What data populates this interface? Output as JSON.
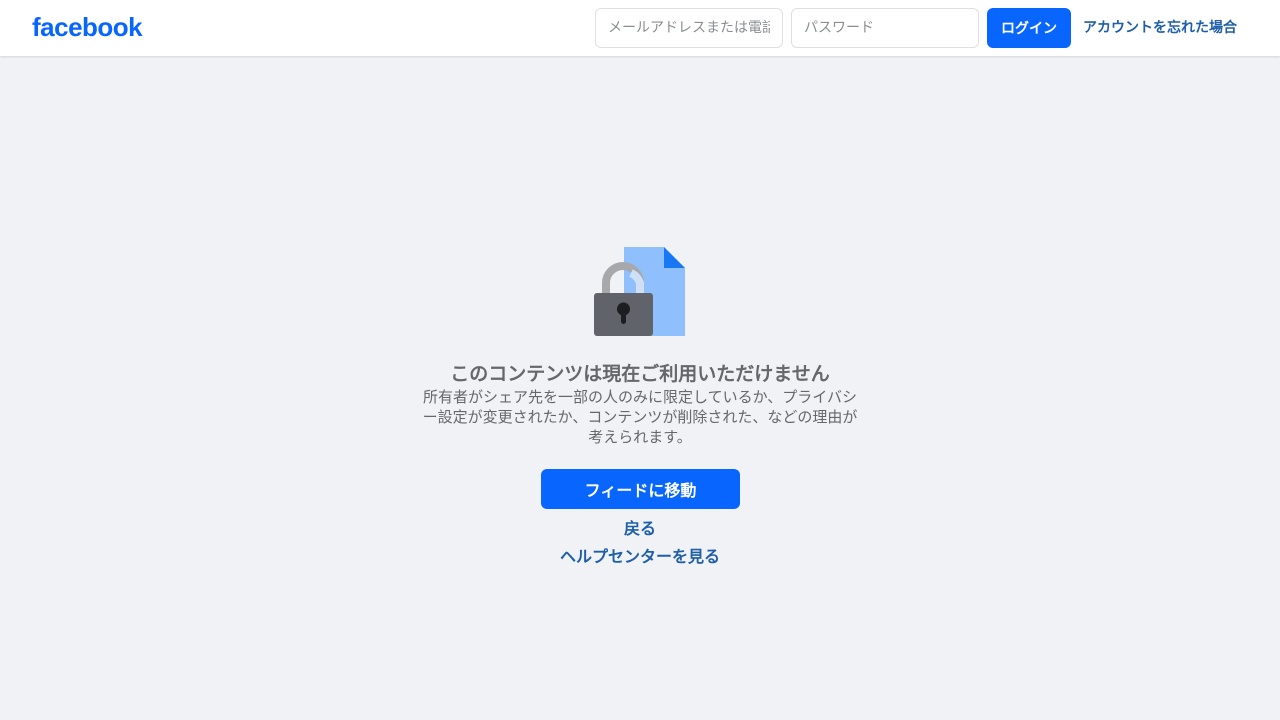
{
  "header": {
    "logo_text": "facebook",
    "email_placeholder": "メールアドレスまたは電話番号",
    "password_placeholder": "パスワード",
    "login_label": "ログイン",
    "forgot_label": "アカウントを忘れた場合"
  },
  "main": {
    "icon": "locked-document-icon",
    "title": "このコンテンツは現在ご利用いただけません",
    "description": "所有者がシェア先を一部の人のみに限定しているか、プライバシー設定が変更されたか、コンテンツが削除された、などの理由が考えられます。",
    "feed_button_label": "フィードに移動",
    "back_link": "戻る",
    "help_link": "ヘルプセンターを見る"
  },
  "colors": {
    "brand_blue": "#0866ff",
    "link_blue": "#1f5ea8",
    "background": "#f0f2f5",
    "muted_text": "#65676b"
  }
}
